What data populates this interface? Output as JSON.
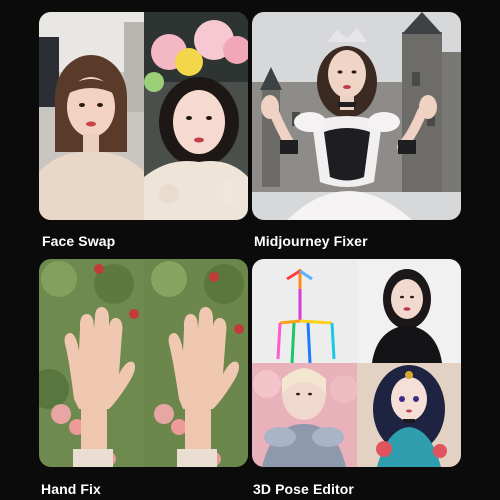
{
  "tools": [
    {
      "title": "Face Swap"
    },
    {
      "title": "Midjourney Fixer"
    },
    {
      "title": "Hand Fix"
    },
    {
      "title": "3D Pose Editor"
    }
  ],
  "colors": {
    "background": "#0b0b0c",
    "label": "#ffffff"
  }
}
